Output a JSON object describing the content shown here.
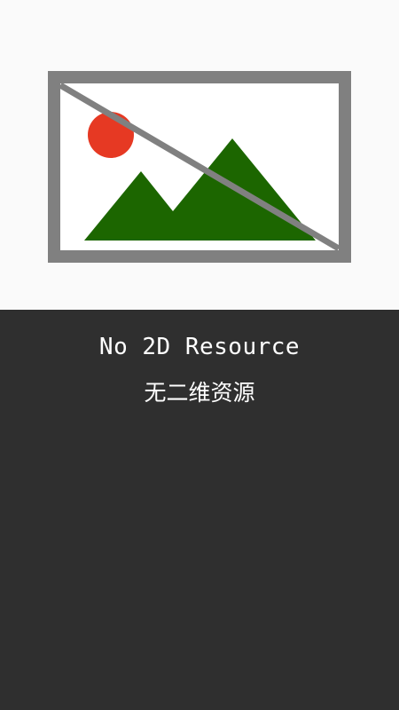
{
  "status": {
    "title_en": "No 2D Resource",
    "title_zh": "无二维资源"
  },
  "placeholder": {
    "icon": "broken-image-icon",
    "colors": {
      "frame": "#808080",
      "sun": "#e63923",
      "mountain": "#1c6600",
      "page_background": "#fafafa",
      "panel_background": "#2f2f2f",
      "text": "#ffffff"
    }
  }
}
